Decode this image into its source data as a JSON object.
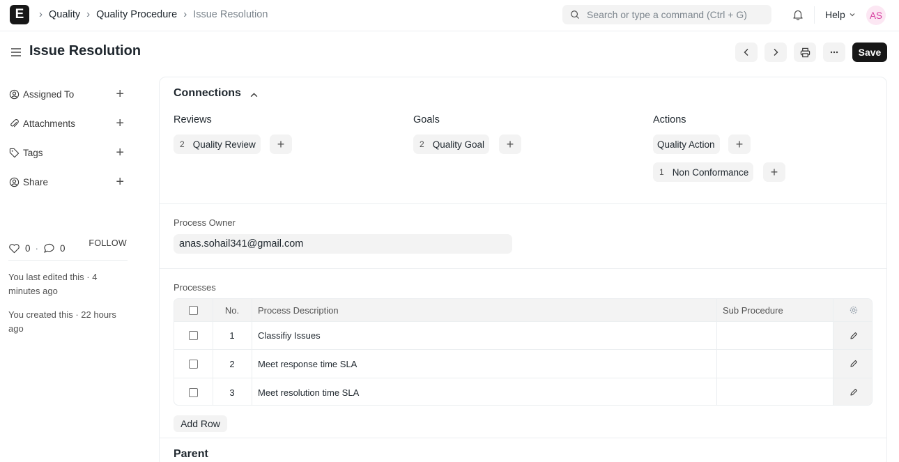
{
  "navbar": {
    "logo": "E",
    "breadcrumbs": [
      "Quality",
      "Quality Procedure",
      "Issue Resolution"
    ],
    "search_placeholder": "Search or type a command (Ctrl + G)",
    "help_label": "Help",
    "avatar_initials": "AS"
  },
  "header": {
    "title": "Issue Resolution",
    "save_label": "Save"
  },
  "sidebar": {
    "items": [
      {
        "label": "Assigned To",
        "icon": "assign-icon"
      },
      {
        "label": "Attachments",
        "icon": "paperclip-icon"
      },
      {
        "label": "Tags",
        "icon": "tag-icon"
      },
      {
        "label": "Share",
        "icon": "share-icon"
      }
    ],
    "likes": "0",
    "comments": "0",
    "follow_label": "FOLLOW",
    "last_edited": "You last edited this · 4 minutes ago",
    "created": "You created this · 22 hours ago"
  },
  "connections": {
    "title": "Connections",
    "groups": [
      {
        "heading": "Reviews",
        "items": [
          {
            "count": "2",
            "label": "Quality Review"
          }
        ]
      },
      {
        "heading": "Goals",
        "items": [
          {
            "count": "2",
            "label": "Quality Goal"
          }
        ]
      },
      {
        "heading": "Actions",
        "items": [
          {
            "count": "",
            "label": "Quality Action"
          },
          {
            "count": "1",
            "label": "Non Conformance"
          }
        ]
      }
    ]
  },
  "process_owner": {
    "label": "Process Owner",
    "value": "anas.sohail341@gmail.com"
  },
  "processes": {
    "label": "Processes",
    "columns": [
      "No.",
      "Process Description",
      "Sub Procedure"
    ],
    "rows": [
      {
        "no": "1",
        "description": "Classifiy Issues",
        "sub_procedure": ""
      },
      {
        "no": "2",
        "description": "Meet response time SLA",
        "sub_procedure": ""
      },
      {
        "no": "3",
        "description": "Meet resolution time SLA",
        "sub_procedure": ""
      }
    ],
    "add_row_label": "Add Row"
  },
  "parent_section": {
    "title": "Parent"
  }
}
